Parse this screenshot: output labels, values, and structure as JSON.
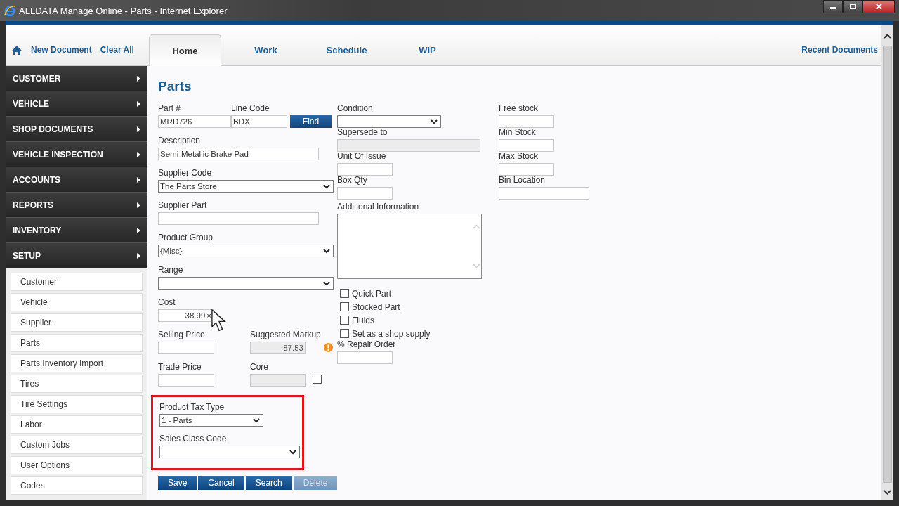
{
  "window": {
    "title": "ALLDATA Manage Online - Parts - Internet Explorer"
  },
  "header": {
    "links": [
      "New Document",
      "Clear All"
    ],
    "tabs": [
      {
        "label": "Home",
        "selected": true
      },
      {
        "label": "Work",
        "selected": false
      },
      {
        "label": "Schedule",
        "selected": false
      },
      {
        "label": "WIP",
        "selected": false
      }
    ],
    "recent": "Recent Documents"
  },
  "sidebar": {
    "menus": [
      "CUSTOMER",
      "VEHICLE",
      "SHOP DOCUMENTS",
      "VEHICLE INSPECTION",
      "ACCOUNTS",
      "REPORTS",
      "INVENTORY",
      "SETUP"
    ],
    "items": [
      "Customer",
      "Vehicle",
      "Supplier",
      "Parts",
      "Parts Inventory Import",
      "Tires",
      "Tire Settings",
      "Labor",
      "Custom Jobs",
      "User Options",
      "Codes"
    ]
  },
  "form": {
    "title": "Parts",
    "part_number": {
      "label": "Part #",
      "value": "MRD726"
    },
    "line_code": {
      "label": "Line Code",
      "value": "BDX"
    },
    "find_button": "Find",
    "description": {
      "label": "Description",
      "value": "Semi-Metallic Brake Pad"
    },
    "supplier_code": {
      "label": "Supplier Code",
      "value": "The Parts Store"
    },
    "supplier_part": {
      "label": "Supplier Part"
    },
    "product_group": {
      "label": "Product Group",
      "value": "{Misc}"
    },
    "range": {
      "label": "Range"
    },
    "cost": {
      "label": "Cost",
      "value": "38.99",
      "clear": "×"
    },
    "selling_price": {
      "label": "Selling Price"
    },
    "suggested_markup": {
      "label": "Suggested Markup",
      "value": "87.53",
      "disabled": true,
      "warning": true
    },
    "trade_price": {
      "label": "Trade Price"
    },
    "core": {
      "label": "Core",
      "disabled": true,
      "checked": false
    },
    "tax_section": {
      "highlighted": true,
      "product_tax_type": {
        "label": "Product Tax Type",
        "value": "1 - Parts"
      },
      "sales_class_code": {
        "label": "Sales Class Code"
      }
    },
    "buttons": [
      {
        "label": "Save",
        "disabled": false
      },
      {
        "label": "Cancel",
        "disabled": false
      },
      {
        "label": "Search",
        "disabled": false
      },
      {
        "label": "Delete",
        "disabled": true
      }
    ],
    "condition": {
      "label": "Condition"
    },
    "supersede_to": {
      "label": "Supersede to",
      "disabled": true
    },
    "unit_of_issue": {
      "label": "Unit Of Issue"
    },
    "box_qty": {
      "label": "Box Qty"
    },
    "additional_information": {
      "label": "Additional Information"
    },
    "options": [
      {
        "label": "Quick Part",
        "checked": false
      },
      {
        "label": "Stocked Part",
        "checked": false
      },
      {
        "label": "Fluids",
        "checked": false
      },
      {
        "label": "Set as a shop supply",
        "checked": false
      }
    ],
    "repair_order_percent": {
      "label": "% Repair Order"
    },
    "free_stock": {
      "label": "Free stock"
    },
    "min_stock": {
      "label": "Min Stock"
    },
    "max_stock": {
      "label": "Max Stock"
    },
    "bin_location": {
      "label": "Bin Location"
    }
  }
}
